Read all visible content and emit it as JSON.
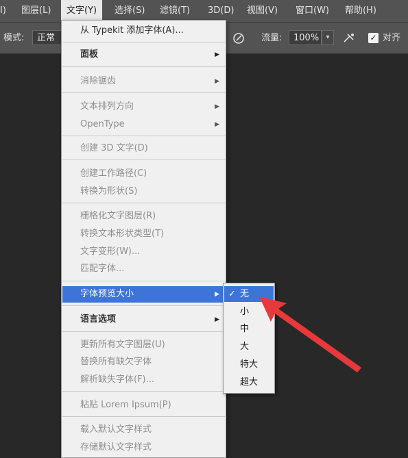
{
  "menubar": {
    "items": [
      {
        "label": "I)"
      },
      {
        "label": "图层(L)"
      },
      {
        "label": "文字(Y)"
      },
      {
        "label": "选择(S)"
      },
      {
        "label": "滤镜(T)"
      },
      {
        "label": "3D(D)"
      },
      {
        "label": "视图(V)"
      },
      {
        "label": "窗口(W)"
      },
      {
        "label": "帮助(H)"
      }
    ],
    "active_label": "文字(Y)"
  },
  "options_bar": {
    "mode_label": "模式:",
    "mode_value": "正常",
    "flow_label": "流量:",
    "flow_value": "100%",
    "align_label": "对齐",
    "align_checked": true
  },
  "type_menu": {
    "items": [
      {
        "label": "从 Typekit 添加字体(A)...",
        "state": "normal"
      },
      {
        "label": "面板",
        "state": "bold",
        "submenu": true
      },
      {
        "label": "消除锯齿",
        "state": "disabled",
        "submenu": true
      },
      {
        "label": "文本排列方向",
        "state": "disabled",
        "submenu": true
      },
      {
        "label": "OpenType",
        "state": "disabled",
        "submenu": true
      },
      {
        "label": "创建 3D 文字(D)",
        "state": "disabled"
      },
      {
        "label": "创建工作路径(C)",
        "state": "disabled"
      },
      {
        "label": "转换为形状(S)",
        "state": "disabled"
      },
      {
        "label": "栅格化文字图层(R)",
        "state": "disabled"
      },
      {
        "label": "转换文本形状类型(T)",
        "state": "disabled"
      },
      {
        "label": "文字变形(W)...",
        "state": "disabled"
      },
      {
        "label": "匹配字体...",
        "state": "disabled"
      },
      {
        "label": "字体预览大小",
        "state": "highlighted",
        "submenu": true
      },
      {
        "label": "语言选项",
        "state": "bold",
        "submenu": true
      },
      {
        "label": "更新所有文字图层(U)",
        "state": "disabled"
      },
      {
        "label": "替换所有缺欠字体",
        "state": "disabled"
      },
      {
        "label": "解析缺失字体(F)...",
        "state": "disabled"
      },
      {
        "label": "粘贴 Lorem Ipsum(P)",
        "state": "disabled"
      },
      {
        "label": "载入默认文字样式",
        "state": "disabled"
      },
      {
        "label": "存储默认文字样式",
        "state": "disabled"
      }
    ]
  },
  "font_preview_submenu": {
    "items": [
      {
        "label": "无",
        "checked": true
      },
      {
        "label": "小",
        "checked": false
      },
      {
        "label": "中",
        "checked": false
      },
      {
        "label": "大",
        "checked": false
      },
      {
        "label": "特大",
        "checked": false
      },
      {
        "label": "超大",
        "checked": false
      }
    ],
    "check_glyph": "✓"
  },
  "icons": {
    "submenu_arrow": "▶",
    "dropdown_arrow": "▾",
    "checkmark": "✓",
    "annotation": "red-arrow"
  },
  "colors": {
    "menu_highlight": "#3d74d8",
    "annotation_arrow": "#e8393a",
    "menubar_bg": "#535353",
    "canvas_bg": "#282828"
  }
}
